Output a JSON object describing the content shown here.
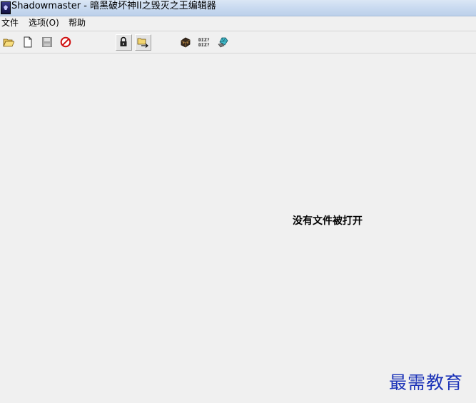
{
  "window": {
    "title": "Shadowmaster - 暗黑破坏神II之毁灭之王编辑器",
    "icon": "shadowmaster-app-icon"
  },
  "menu": {
    "items": [
      {
        "label": "文件"
      },
      {
        "label": "选项(O)"
      },
      {
        "label": "帮助"
      }
    ]
  },
  "toolbar": {
    "buttons": [
      {
        "name": "open-folder-icon",
        "enabled": true
      },
      {
        "name": "new-file-icon",
        "enabled": true
      },
      {
        "name": "save-icon",
        "enabled": false
      },
      {
        "name": "no-entry-icon",
        "enabled": true
      },
      {
        "name": "lock-icon",
        "enabled": true,
        "pressed": true
      },
      {
        "name": "folder-arrow-icon",
        "enabled": true,
        "pressed": true
      },
      {
        "name": "horadric-cube-icon",
        "enabled": true
      },
      {
        "name": "diz-text-icon",
        "enabled": true
      },
      {
        "name": "gem-hand-icon",
        "enabled": true
      }
    ]
  },
  "main": {
    "empty_message": "没有文件被打开"
  },
  "watermark": {
    "text": "最需教育"
  },
  "colors": {
    "titlebar": "#c9daf0",
    "background": "#f0f0f0",
    "watermark": "#1c33b8"
  }
}
